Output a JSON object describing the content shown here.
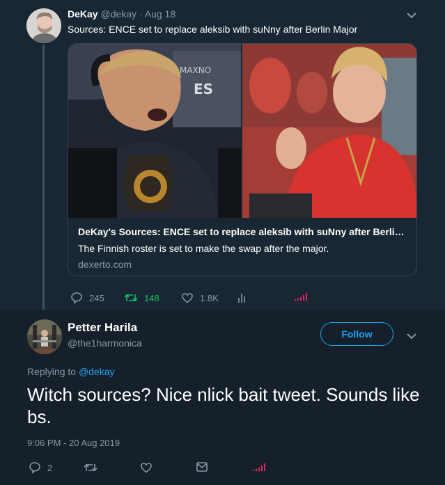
{
  "parent_tweet": {
    "author_name": "DeKay",
    "author_handle": "@dekay",
    "separator": "·",
    "date": "Aug 18",
    "text": "Sources: ENCE set to replace aleksib with suNny after Berlin Major",
    "card": {
      "title": "DeKay's Sources: ENCE set to replace aleksib with suNny after Berlin Major",
      "description": "The Finnish roster is set to make the swap after the major.",
      "domain": "dexerto.com"
    },
    "actions": {
      "replies": "245",
      "retweets": "148",
      "likes": "1.8K"
    },
    "icons": [
      "reply-icon",
      "retweet-icon",
      "like-icon",
      "analytics-icon",
      "signal-icon",
      "chevron-down-icon"
    ]
  },
  "reply_tweet": {
    "author_name": "Petter Harila",
    "author_handle": "@the1harmonica",
    "follow_label": "Follow",
    "replying_prefix": "Replying to",
    "replying_to": "@dekay",
    "text": "Witch sources? Nice nlick bait tweet. Sounds like bs.",
    "timestamp": "9:06 PM - 20 Aug 2019",
    "actions": {
      "replies": "2"
    },
    "icons": [
      "reply-icon",
      "retweet-icon",
      "like-icon",
      "message-icon",
      "signal-icon",
      "chevron-down-icon"
    ]
  },
  "colors": {
    "background": "#15202b",
    "parent_background": "#192734",
    "accent": "#1da1f2",
    "retweet_active": "#17bf63",
    "muted": "#8899a6",
    "signal": "#e0245e"
  }
}
